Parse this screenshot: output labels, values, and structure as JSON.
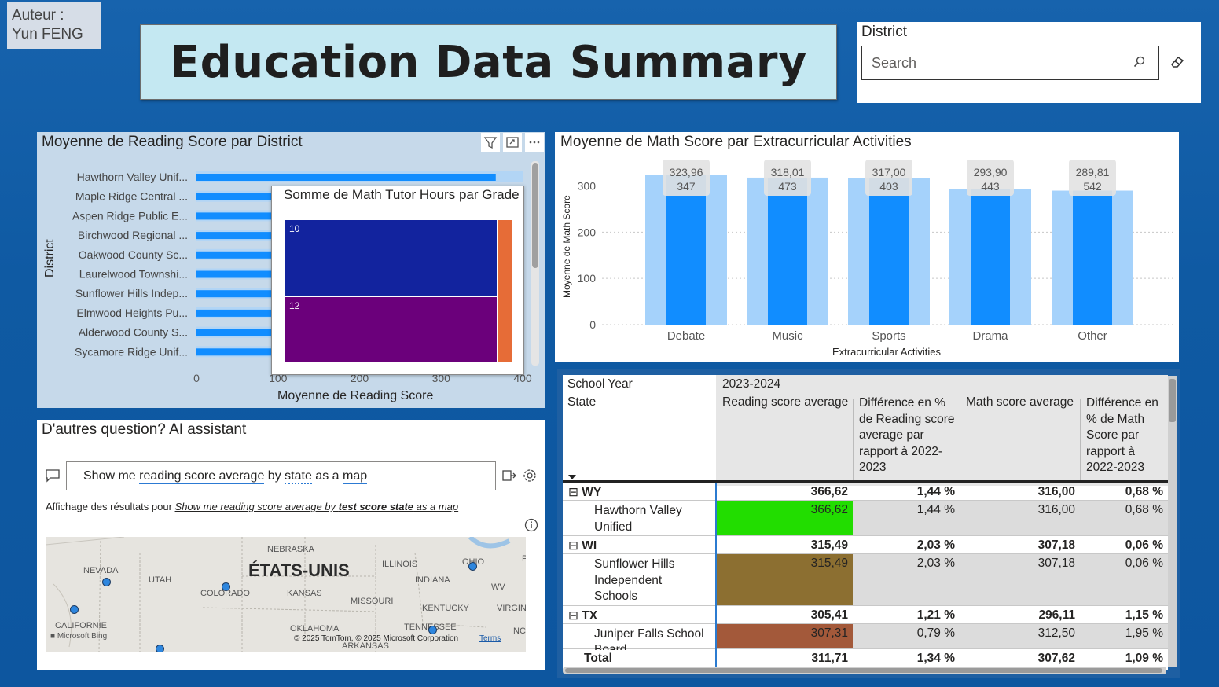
{
  "author": {
    "line1": "Auteur :",
    "line2": "Yun FENG"
  },
  "title": "Education Data Summary",
  "slicer": {
    "label": "District",
    "placeholder": "Search"
  },
  "reading_chart": {
    "title": "Moyenne de Reading Score par District",
    "ylabel": "District",
    "xlabel": "Moyenne de Reading Score",
    "icons": [
      "filter-icon",
      "focus-mode-icon",
      "more-options-icon"
    ]
  },
  "tooltip": {
    "title": "Somme de Math Tutor Hours par Grade",
    "tiles": [
      {
        "label": "10",
        "color": "#12239e"
      },
      {
        "label": "12",
        "color": "#6b007b"
      },
      {
        "label": "",
        "color": "#e66c37"
      }
    ]
  },
  "math_chart": {
    "title": "Moyenne de Math Score par Extracurricular Activities",
    "ylabel": "Moyenne de Math Score",
    "xlabel": "Extracurricular Activities",
    "labels_bottom": [
      "347",
      "473",
      "403",
      "443",
      "542"
    ]
  },
  "ai": {
    "title": "D'autres question? AI assistant",
    "query_parts": [
      "Show me ",
      "reading score average",
      " by ",
      "state",
      " as a ",
      "map"
    ],
    "results_prefix": "Affichage des résultats pour ",
    "results_query_parts": [
      "Show me reading score average by ",
      "test score state",
      " as a map"
    ],
    "map": {
      "country": "ÉTATS-UNIS",
      "labels": [
        "NEBRASKA",
        "NEVADA",
        "UTAH",
        "COLORADO",
        "KANSAS",
        "ILLINOIS",
        "OHIO",
        "INDIANA",
        "MISSOURI",
        "KENTUCKY",
        "WV",
        "VIRGIN",
        "CALIFORNIE",
        "OKLAHOMA",
        "TENNESSEE",
        "NC",
        "ARKANSAS",
        "P"
      ],
      "attribution": "© 2025 TomTom, © 2025 Microsoft Corporation",
      "terms": "Terms",
      "logo": "Microsoft Bing"
    }
  },
  "matrix": {
    "col_header_row": "School Year",
    "row_header": "State",
    "year": "2023-2024",
    "columns": [
      {
        "line1": "Reading score average"
      },
      {
        "lines": [
          "Différence en %",
          "de Reading score",
          "average par",
          "rapport à 2022-",
          "2023"
        ]
      },
      {
        "line1": "Math score average"
      },
      {
        "lines": [
          "Différence en",
          "% de Math",
          "Score par",
          "rapport à",
          "2022-2023"
        ]
      }
    ],
    "rows": [
      {
        "type": "state",
        "toggle": "⊟",
        "name": "WY",
        "values": [
          "366,62",
          "1,44 %",
          "316,00",
          "0,68 %"
        ]
      },
      {
        "type": "district",
        "name_lines": [
          "Hawthorn Valley",
          "Unified"
        ],
        "values": [
          "366,62",
          "1,44 %",
          "316,00",
          "0,68 %"
        ],
        "color": "#22dd00"
      },
      {
        "type": "state",
        "toggle": "⊟",
        "name": "WI",
        "values": [
          "315,49",
          "2,03 %",
          "307,18",
          "0,06 %"
        ]
      },
      {
        "type": "district",
        "name_lines": [
          "Sunflower Hills",
          "Independent",
          "Schools"
        ],
        "values": [
          "315,49",
          "2,03 %",
          "307,18",
          "0,06 %"
        ],
        "color": "#8c6f31"
      },
      {
        "type": "state",
        "toggle": "⊟",
        "name": "TX",
        "values": [
          "305,41",
          "1,21 %",
          "296,11",
          "1,15 %"
        ]
      },
      {
        "type": "district",
        "name_lines": [
          "Juniper Falls School",
          "Board"
        ],
        "values": [
          "307,31",
          "0,79 %",
          "312,50",
          "1,95 %"
        ],
        "color": "#a3593a"
      },
      {
        "type": "total",
        "name": "Total",
        "values": [
          "311,71",
          "1,34 %",
          "307,62",
          "1,09 %"
        ]
      }
    ]
  },
  "chart_data": [
    {
      "type": "bar",
      "title": "Moyenne de Reading Score par District",
      "orientation": "horizontal",
      "categories": [
        "Hawthorn Valley Unif...",
        "Maple Ridge Central ...",
        "Aspen Ridge Public E...",
        "Birchwood Regional ...",
        "Oakwood County Sc...",
        "Laurelwood Townshi...",
        "Sunflower Hills Indep...",
        "Elmwood Heights Pu...",
        "Alderwood County S...",
        "Sycamore Ridge Unif..."
      ],
      "values": [
        367,
        363,
        362,
        361,
        360,
        358,
        357,
        356,
        355,
        354
      ],
      "xlabel": "Moyenne de Reading Score",
      "ylabel": "District",
      "xlim": [
        0,
        400
      ],
      "xticks": [
        "0",
        "100",
        "200",
        "300",
        "400"
      ],
      "color": "#118dff"
    },
    {
      "type": "bar",
      "title": "Moyenne de Math Score par Extracurricular Activities",
      "categories": [
        "Debate",
        "Music",
        "Sports",
        "Drama",
        "Other"
      ],
      "values": [
        323.96,
        318.01,
        317.0,
        293.9,
        289.81
      ],
      "data_labels": [
        "323,96",
        "318,01",
        "317,00",
        "293,90",
        "289,81"
      ],
      "xlabel": "Extracurricular Activities",
      "ylabel": "Moyenne de Math Score",
      "ylim": [
        0,
        340
      ],
      "yticks": [
        "0",
        "100",
        "200",
        "300"
      ],
      "color": "#118dff",
      "background_color": "#a5d2fb"
    }
  ]
}
